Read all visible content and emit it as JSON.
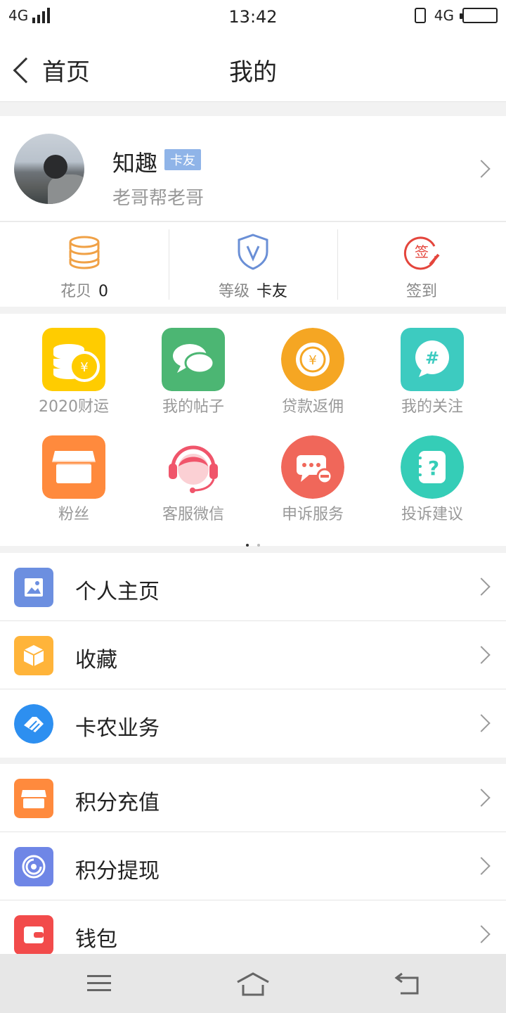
{
  "status_bar": {
    "network_left": "4G",
    "time": "13:42",
    "network_right": "4G"
  },
  "nav": {
    "back_label": "首页",
    "title": "我的"
  },
  "profile": {
    "name": "知趣",
    "badge": "卡友",
    "subtitle": "老哥帮老哥"
  },
  "stats": [
    {
      "label": "花贝",
      "value": "0",
      "icon": "coins-stack-icon"
    },
    {
      "label": "等级",
      "value": "卡友",
      "icon": "shield-v-icon"
    },
    {
      "label": "签到",
      "value": "",
      "icon": "sign-in-stamp-icon"
    }
  ],
  "grid": [
    {
      "label": "2020财运",
      "icon": "gold-coins-icon",
      "color": "#ffcc00"
    },
    {
      "label": "我的帖子",
      "icon": "chat-bubbles-icon",
      "color": "#4cb673"
    },
    {
      "label": "贷款返佣",
      "icon": "yuan-coin-icon",
      "color": "#f5a623"
    },
    {
      "label": "我的关注",
      "icon": "hashtag-bubble-icon",
      "color": "#3dcbc0"
    },
    {
      "label": "粉丝",
      "icon": "storefront-icon",
      "color": "#ff8a3d"
    },
    {
      "label": "客服微信",
      "icon": "headset-agent-icon",
      "color": "#f0556b"
    },
    {
      "label": "申诉服务",
      "icon": "message-minus-icon",
      "color": "#f0675a"
    },
    {
      "label": "投诉建议",
      "icon": "question-notebook-icon",
      "color": "#35cdb7"
    }
  ],
  "pager": {
    "pages": 2,
    "current": 1
  },
  "list_group_1": [
    {
      "label": "个人主页",
      "icon": "picture-icon",
      "color": "#6c8fe0"
    },
    {
      "label": "收藏",
      "icon": "box-icon",
      "color": "#ffb43a"
    },
    {
      "label": "卡农业务",
      "icon": "handshake-icon",
      "color": "#2d8ff0"
    }
  ],
  "list_group_2": [
    {
      "label": "积分充值",
      "icon": "store-icon",
      "color": "#ff8a3d"
    },
    {
      "label": "积分提现",
      "icon": "spiral-icon",
      "color": "#6f86e6"
    },
    {
      "label": "钱包",
      "icon": "wallet-icon",
      "color": "#f24b4b"
    }
  ]
}
